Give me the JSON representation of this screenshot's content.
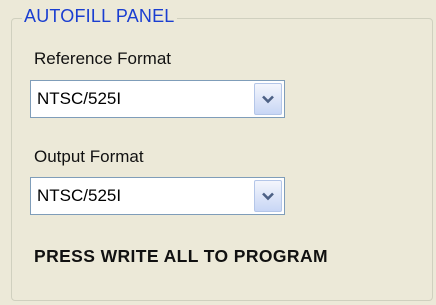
{
  "panel": {
    "title": "AUTOFILL PANEL",
    "title_color": "#1a3ed1"
  },
  "reference": {
    "label": "Reference Format",
    "value": "NTSC/525I",
    "icon": "chevron-down-icon"
  },
  "output": {
    "label": "Output Format",
    "value": "NTSC/525I",
    "icon": "chevron-down-icon"
  },
  "instruction": "PRESS WRITE ALL TO PROGRAM"
}
